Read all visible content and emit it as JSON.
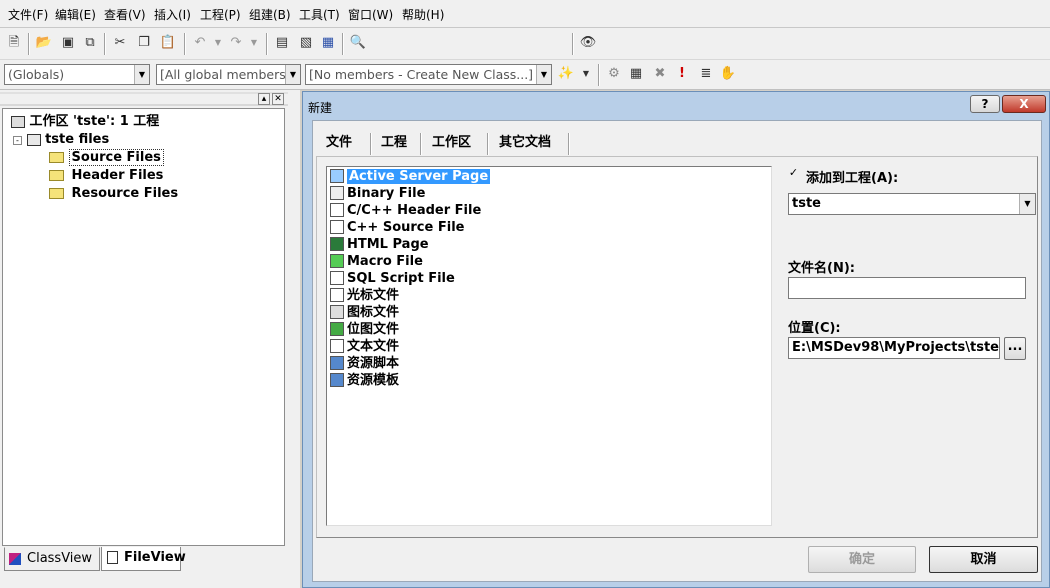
{
  "menu": [
    "文件(F)",
    "编辑(E)",
    "查看(V)",
    "插入(I)",
    "工程(P)",
    "组建(B)",
    "工具(T)",
    "窗口(W)",
    "帮助(H)"
  ],
  "toolbar": {
    "find_value": "",
    "combo_globals": "(Globals)",
    "combo_members": "[All global members",
    "combo_class": "[No members - Create New Class...]"
  },
  "workspace": {
    "root": "工作区 'tste': 1 工程",
    "project": "tste files",
    "folders": [
      "Source Files",
      "Header Files",
      "Resource Files"
    ],
    "tabs": [
      "ClassView",
      "FileView"
    ]
  },
  "dialog": {
    "title": "新建",
    "help": "?",
    "close": "X",
    "tabs": [
      "文件",
      "工程",
      "工作区",
      "其它文档"
    ],
    "items": [
      "Active Server Page",
      "Binary File",
      "C/C++ Header File",
      "C++ Source File",
      "HTML Page",
      "Macro File",
      "SQL Script File",
      "光标文件",
      "图标文件",
      "位图文件",
      "文本文件",
      "资源脚本",
      "资源模板"
    ],
    "add_to_project_label": "添加到工程(A):",
    "add_to_project_checked": true,
    "project_value": "tste",
    "filename_label": "文件名(N):",
    "filename_value": "",
    "location_label": "位置(C):",
    "location_value": "E:\\MSDev98\\MyProjects\\tste",
    "browse": "...",
    "ok": "确定",
    "cancel": "取消"
  },
  "colors": {
    "selection": "#3399ff",
    "dialog_frame": "#b8cfe8"
  }
}
